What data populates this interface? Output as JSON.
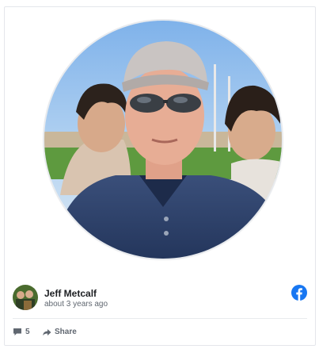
{
  "post": {
    "author": "Jeff Metcalf",
    "time": "about 3 years ago",
    "comment_count": "5",
    "share_label": "Share"
  },
  "icons": {
    "network": "facebook-icon",
    "comments": "comment-icon",
    "share": "share-arrow-icon"
  },
  "colors": {
    "facebook_blue": "#1877f2",
    "meta_text": "#606770",
    "name_text": "#1c1e21"
  }
}
